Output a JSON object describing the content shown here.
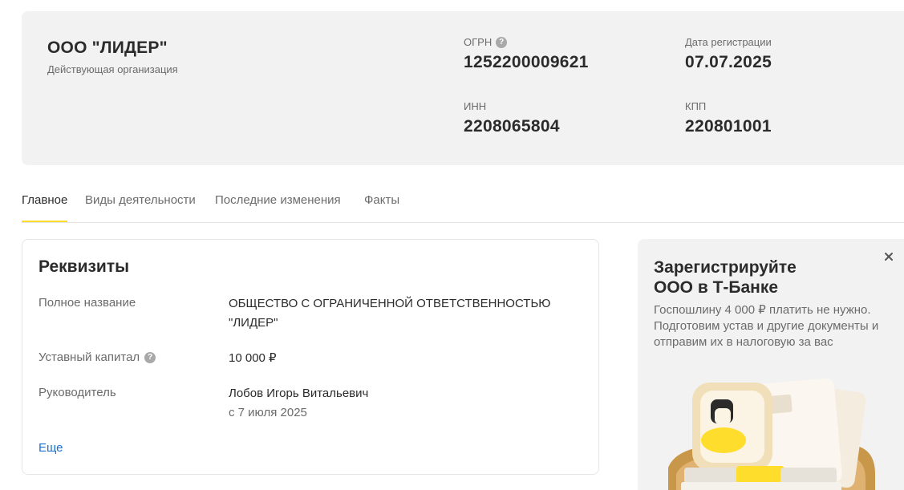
{
  "company": {
    "name": "ООО \"ЛИДЕР\"",
    "status": "Действующая организация"
  },
  "fields": {
    "ogrn": {
      "label": "ОГРН",
      "value": "1252200009621",
      "icon": "help-icon"
    },
    "reg_date": {
      "label": "Дата регистрации",
      "value": "07.07.2025"
    },
    "inn": {
      "label": "ИНН",
      "value": "2208065804"
    },
    "kpp": {
      "label": "КПП",
      "value": "220801001"
    }
  },
  "tabs": [
    {
      "label": "Главное",
      "active": true
    },
    {
      "label": "Виды деятельности",
      "active": false
    },
    {
      "label": "Последние изменения",
      "active": false
    },
    {
      "label": "Факты",
      "active": false
    }
  ],
  "requisites": {
    "title": "Реквизиты",
    "full_name": {
      "label": "Полное название",
      "line1": "ОБЩЕСТВО С ОГРАНИЧЕННОЙ ОТВЕТСТВЕННОСТЬЮ",
      "line2": "\"ЛИДЕР\""
    },
    "capital": {
      "label": "Уставный капитал",
      "value": "10 000 ₽",
      "icon": "help-icon"
    },
    "director": {
      "label": "Руководитель",
      "name": "Лобов Игорь Витальевич",
      "since": "с 7 июля 2025"
    },
    "more_label": "Еще"
  },
  "promo": {
    "title_line1": "Зарегистрируйте",
    "title_line2": "ООО в Т-Банке",
    "text_line1": "Госпошлину 4 000 ₽ платить не нужно.",
    "text_line2": "Подготовим устав и другие документы и",
    "text_line3": "отправим их в налоговую за вас",
    "close_icon": "close-icon"
  },
  "colors": {
    "accent": "#ffdd2d",
    "link": "#1a6fd3",
    "card_bg": "#f2f2f2"
  }
}
